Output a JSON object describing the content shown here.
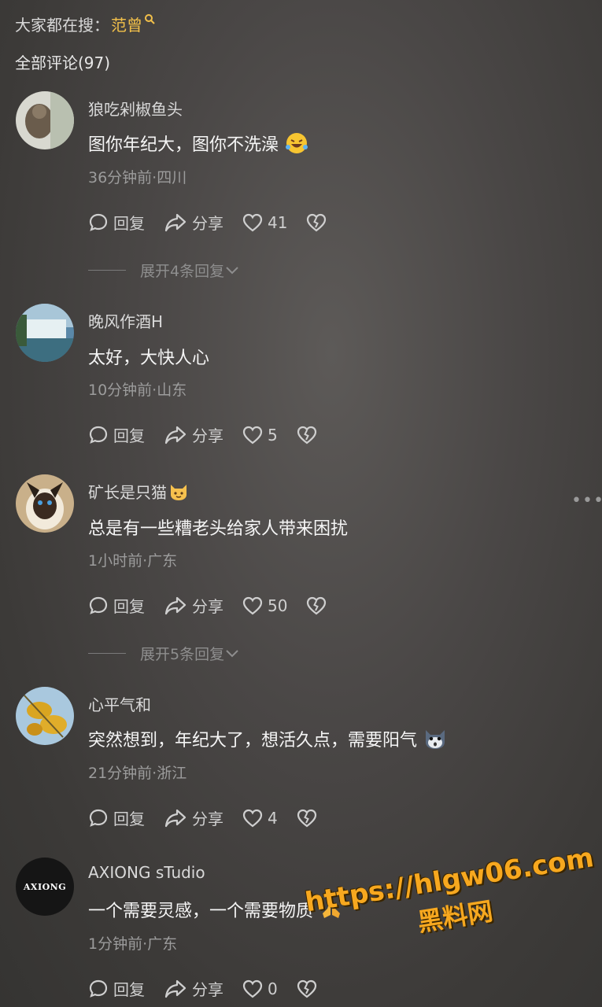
{
  "header": {
    "search_prefix": "大家都在搜：",
    "search_keyword": "范曾",
    "comments_title": "全部评论(97)"
  },
  "comments": [
    {
      "username": "狼吃剁椒鱼头",
      "text": "图你年纪大，图你不洗澡",
      "emoji": "laughing-crying-emoji",
      "meta": "36分钟前·四川",
      "reply_label": "回复",
      "share_label": "分享",
      "likes": "41",
      "expand": "展开4条回复"
    },
    {
      "username": "晚风作酒H",
      "text": "太好，大快人心",
      "meta": "10分钟前·山东",
      "reply_label": "回复",
      "share_label": "分享",
      "likes": "5"
    },
    {
      "username": "矿长是只猫",
      "username_emoji": "cat-face-emoji",
      "text": "总是有一些糟老头给家人带来困扰",
      "meta": "1小时前·广东",
      "reply_label": "回复",
      "share_label": "分享",
      "likes": "50",
      "expand": "展开5条回复"
    },
    {
      "username": "心平气和",
      "text": "突然想到，年纪大了，想活久点，需要阳气",
      "emoji": "shocked-cat-emoji",
      "meta": "21分钟前·浙江",
      "reply_label": "回复",
      "share_label": "分享",
      "likes": "4"
    },
    {
      "username": "AXIONG sTudio",
      "avatar_text": "AXIONG",
      "text": "一个需要灵感，一个需要物质",
      "emoji": "praying-hands-emoji",
      "meta": "1分钟前·广东",
      "reply_label": "回复",
      "share_label": "分享",
      "likes": "0"
    }
  ],
  "watermark": {
    "url": "https://hlgw06.com",
    "site": "黑料网"
  },
  "colors": {
    "keyword": "#f2c04a",
    "watermark": "#f7a81f"
  }
}
